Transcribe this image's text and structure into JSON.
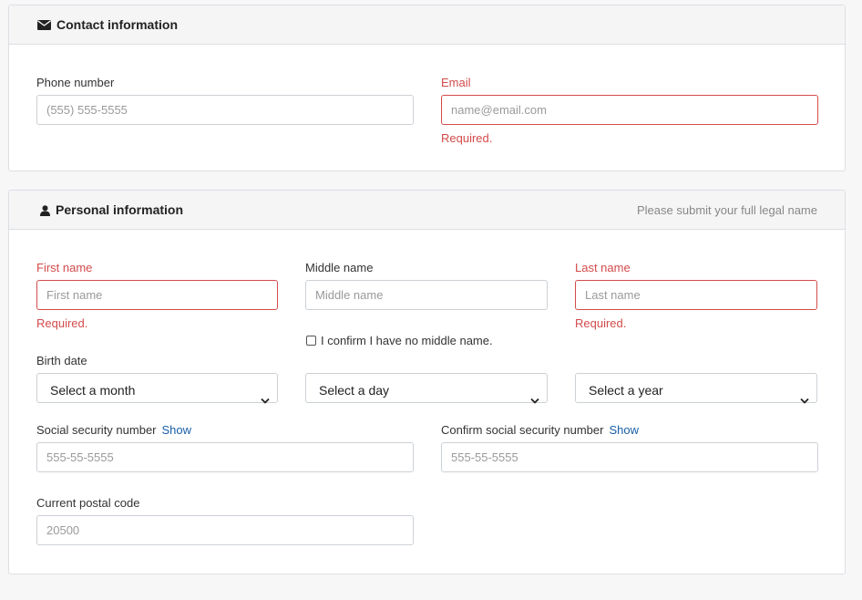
{
  "contact": {
    "title": "Contact information",
    "icon": "envelope-icon",
    "phone": {
      "label": "Phone number",
      "placeholder": "(555) 555-5555"
    },
    "email": {
      "label": "Email",
      "placeholder": "name@email.com",
      "error": "Required."
    }
  },
  "personal": {
    "title": "Personal information",
    "icon": "user-icon",
    "hint": "Please submit your full legal name",
    "first_name": {
      "label": "First name",
      "placeholder": "First name",
      "error": "Required."
    },
    "middle_name": {
      "label": "Middle name",
      "placeholder": "Middle name"
    },
    "last_name": {
      "label": "Last name",
      "placeholder": "Last name",
      "error": "Required."
    },
    "no_middle_name": "I confirm I have no middle name.",
    "birth_date": {
      "label": "Birth date",
      "month": "Select a month",
      "day": "Select a day",
      "year": "Select a year"
    },
    "ssn": {
      "label": "Social security number",
      "show": "Show",
      "placeholder": "555-55-5555"
    },
    "ssn_confirm": {
      "label": "Confirm social security number",
      "show": "Show",
      "placeholder": "555-55-5555"
    },
    "postal": {
      "label": "Current postal code",
      "placeholder": "20500"
    }
  },
  "colors": {
    "error": "#d34b4b",
    "link": "#1a5fa8",
    "border": "#ccd1d6"
  }
}
